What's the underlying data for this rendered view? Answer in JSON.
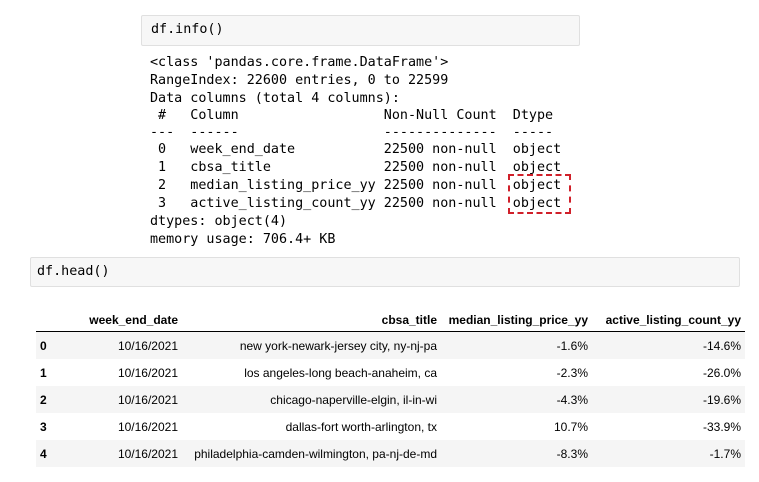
{
  "cell1": {
    "code": "df.info()"
  },
  "info_output": {
    "lines": [
      "<class 'pandas.core.frame.DataFrame'>",
      "RangeIndex: 22600 entries, 0 to 22599",
      "Data columns (total 4 columns):",
      " #   Column                  Non-Null Count  Dtype ",
      "---  ------                  --------------  ----- ",
      " 0   week_end_date           22500 non-null  object",
      " 1   cbsa_title              22500 non-null  object",
      " 2   median_listing_price_yy 22500 non-null  object",
      " 3   active_listing_count_yy 22500 non-null  object",
      "dtypes: object(4)",
      "memory usage: 706.4+ KB"
    ],
    "highlight_color": "#d0202a"
  },
  "cell2": {
    "code": "df.head()"
  },
  "table": {
    "headers": [
      "",
      "week_end_date",
      "cbsa_title",
      "median_listing_price_yy",
      "active_listing_count_yy"
    ],
    "rows": [
      [
        "0",
        "10/16/2021",
        "new york-newark-jersey city, ny-nj-pa",
        "-1.6%",
        "-14.6%"
      ],
      [
        "1",
        "10/16/2021",
        "los angeles-long beach-anaheim, ca",
        "-2.3%",
        "-26.0%"
      ],
      [
        "2",
        "10/16/2021",
        "chicago-naperville-elgin, il-in-wi",
        "-4.3%",
        "-19.6%"
      ],
      [
        "3",
        "10/16/2021",
        "dallas-fort worth-arlington, tx",
        "10.7%",
        "-33.9%"
      ],
      [
        "4",
        "10/16/2021",
        "philadelphia-camden-wilmington, pa-nj-de-md",
        "-8.3%",
        "-1.7%"
      ]
    ]
  }
}
